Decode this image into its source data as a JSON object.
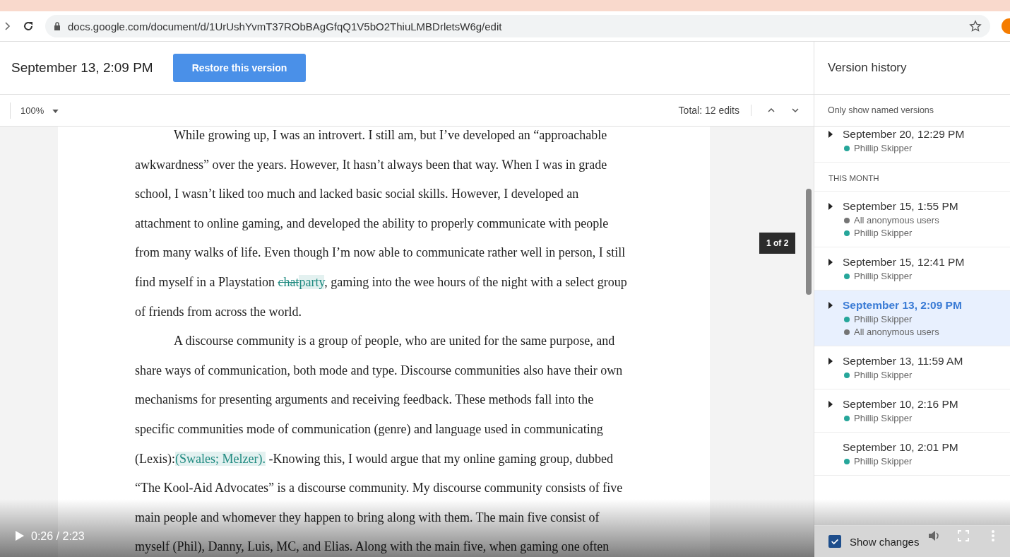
{
  "browser": {
    "url": "docs.google.com/document/d/1UrUshYvmT37RObBAgGfqQ1V5bO2ThiuLMBDrletsW6g/edit"
  },
  "header": {
    "title": "September 13, 2:09 PM",
    "restore_button": "Restore this version"
  },
  "toolbar": {
    "zoom": "100%",
    "total_edits": "Total: 12 edits"
  },
  "document": {
    "paragraphs": [
      [
        {
          "kind": "normal",
          "text": "While growing up, I was an introvert. I still am, but I’ve developed an “approachable awkwardness” over the years. However, It hasn’t always been that way. When I was in grade school, I wasn’t liked too much and lacked basic social skills. However, I developed an attachment to online gaming, and developed the ability to properly communicate with people from many walks of life. Even though I’m now able to communicate  rather well in person, I still find myself in a Playstation "
        },
        {
          "kind": "deleted",
          "text": "chat"
        },
        {
          "kind": "inserted",
          "text": "party"
        },
        {
          "kind": "normal",
          "text": ", gaming into the wee hours of the night with a select group of friends from across the world."
        }
      ],
      [
        {
          "kind": "normal",
          "text": "A discourse community is a group of people, who are united for the same purpose, and share ways of communication, both mode and type. Discourse communities also have their own mechanisms for presenting arguments and receiving feedback. These methods fall into the specific communities mode of communication (genre) and language used in communicating (Lexis):"
        },
        {
          "kind": "inserted",
          "text": "(Swales; Melzer)."
        },
        {
          "kind": "normal",
          "text": " -Knowing this, I would argue that my online gaming group, dubbed “The Kool-Aid Advocates” is a discourse community. My discourse community consists of five main people and whomever they happen to bring along with them. The main five consist of myself (Phil), Danny, Luis, MC, and Elias. Along with the main five, when gaming one often"
        }
      ]
    ]
  },
  "change_tooltip": "1 of 2",
  "version_history": {
    "title": "Version history",
    "filter_label": "Only show named versions",
    "groups": [
      {
        "versions": [
          {
            "date": "September 20, 12:29 PM",
            "expandable": true,
            "selected": false,
            "users": [
              {
                "name": "Phillip Skipper",
                "color": "#26a69a"
              }
            ]
          }
        ]
      },
      {
        "heading": "THIS MONTH",
        "versions": [
          {
            "date": "September 15, 1:55 PM",
            "expandable": true,
            "selected": false,
            "users": [
              {
                "name": "All anonymous users",
                "color": "#757575"
              },
              {
                "name": "Phillip Skipper",
                "color": "#26a69a"
              }
            ]
          },
          {
            "date": "September 15, 12:41 PM",
            "expandable": true,
            "selected": false,
            "users": [
              {
                "name": "Phillip Skipper",
                "color": "#26a69a"
              }
            ]
          },
          {
            "date": "September 13, 2:09 PM",
            "expandable": true,
            "selected": true,
            "users": [
              {
                "name": "Phillip Skipper",
                "color": "#26a69a"
              },
              {
                "name": "All anonymous users",
                "color": "#757575"
              }
            ]
          },
          {
            "date": "September 13, 11:59 AM",
            "expandable": true,
            "selected": false,
            "users": [
              {
                "name": "Phillip Skipper",
                "color": "#26a69a"
              }
            ]
          },
          {
            "date": "September 10, 2:16 PM",
            "expandable": true,
            "selected": false,
            "users": [
              {
                "name": "Phillip Skipper",
                "color": "#26a69a"
              }
            ]
          },
          {
            "date": "September 10, 2:01 PM",
            "expandable": false,
            "selected": false,
            "users": [
              {
                "name": "Phillip Skipper",
                "color": "#26a69a"
              }
            ]
          }
        ]
      }
    ],
    "show_changes": {
      "label": "Show changes",
      "checked": true
    }
  },
  "video_player": {
    "time": "0:26 / 2:23"
  }
}
